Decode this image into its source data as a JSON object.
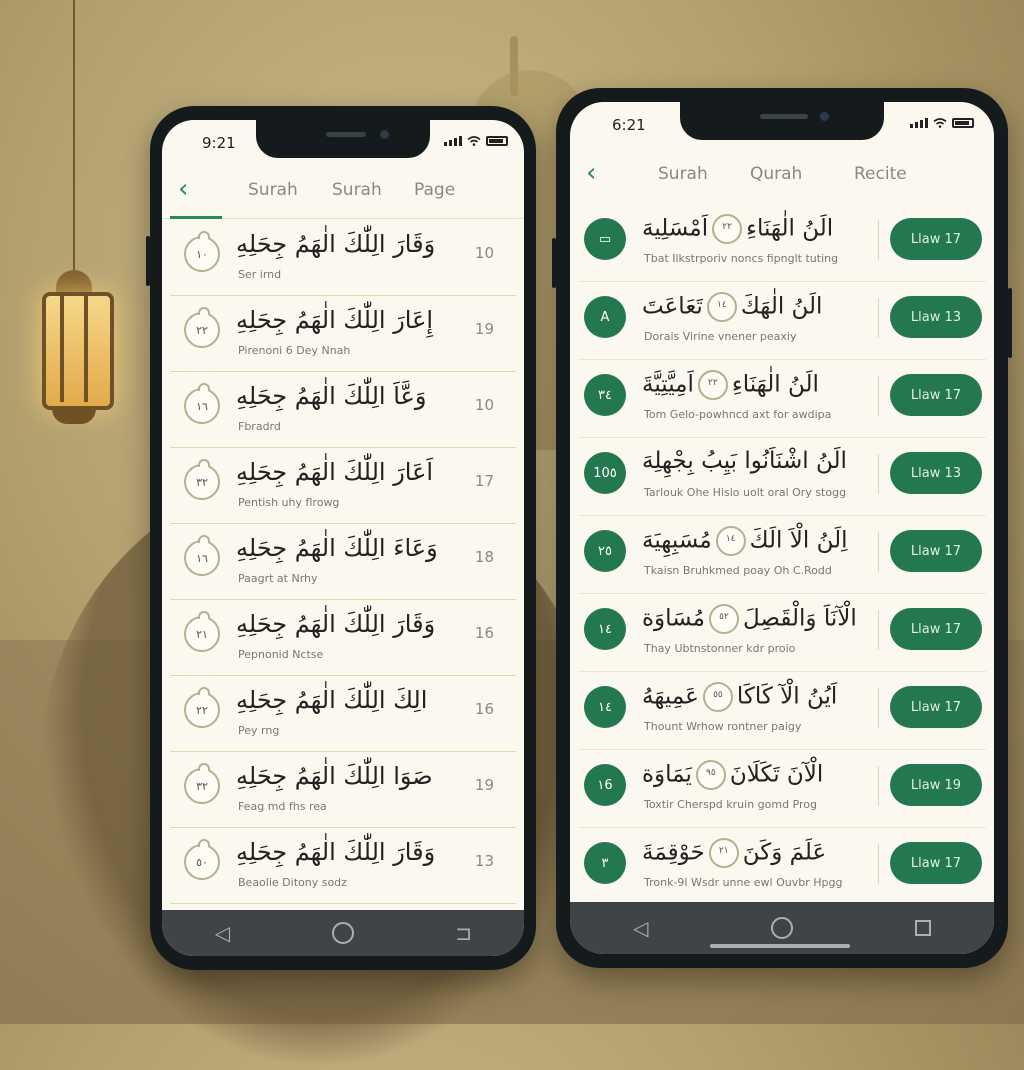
{
  "left_phone": {
    "status_time": "9:21",
    "tabs": [
      "Surah",
      "Surah",
      "Page"
    ],
    "rows": [
      {
        "badge": "١٠",
        "arabic": "وَقَارَ الِلّٰكَ الٰهَمُ جِحَلِهِ",
        "subtitle": "Ser irnd",
        "number": "10"
      },
      {
        "badge": "٢٢",
        "arabic": "إِعَارَ الِلّٰكَ الٰهَمُ جِحَلِهِ",
        "subtitle": "Pirenoni 6 Dey Nnah",
        "number": "19"
      },
      {
        "badge": "١٦",
        "arabic": "وَعَّاَ الِلّٰكَ الٰهَمُ جِحَلِهِ",
        "subtitle": "Fbradrd",
        "number": "10"
      },
      {
        "badge": "٣٢",
        "arabic": "اَعَارَ الِلّٰكَ الٰهَمُ جِحَلِهِ",
        "subtitle": "Pentish uhy flrowg",
        "number": "17"
      },
      {
        "badge": "١٦",
        "arabic": "وَعَاءَ الِلّٰكَ الٰهَمُ جِحَلِهِ",
        "subtitle": "Paagrt at Nrhy",
        "number": "18"
      },
      {
        "badge": "٢١",
        "arabic": "وَقَارَ الِلّٰكَ الٰهَمُ جِحَلِهِ",
        "subtitle": "Pepnonid Nctse",
        "number": "16"
      },
      {
        "badge": "٢٢",
        "arabic": "الِكَ الِلّٰكَ الٰهَمُ جِحَلِهِ",
        "subtitle": "Pey rng",
        "number": "16"
      },
      {
        "badge": "٣٢",
        "arabic": "صَوَا الِلّٰكَ الٰهَمُ جِحَلِهِ",
        "subtitle": "Feag md fhs rea",
        "number": "19"
      },
      {
        "badge": "٥٠",
        "arabic": "وَقَارَ الِلّٰكَ الٰهَمُ جِحَلِهِ",
        "subtitle": "Beaolie Ditony sodz",
        "number": "13"
      }
    ]
  },
  "right_phone": {
    "status_time": "6:21",
    "tabs": [
      "Surah",
      "Qurah",
      "Recite"
    ],
    "rows": [
      {
        "circle": "▭",
        "arabic_a": "الَنُ الٰهَنَاءِ",
        "medal": "٢٢",
        "arabic_b": "اَمْسَلِيهَ",
        "subtitle": "Tbat Ilkstrporiv noncs fipnglt tuting",
        "pill": "Llaw 17"
      },
      {
        "circle": "A",
        "arabic_a": "الَنُ الٰهَكَ",
        "medal": "١٤",
        "arabic_b": "تَعَاعَتَ",
        "subtitle": "Dorais Virine vnener peaxiy",
        "pill": "Llaw 13"
      },
      {
        "circle": "٣٤",
        "arabic_a": "الَنُ الٰهَنَاءِ",
        "medal": "٢٢",
        "arabic_b": "اَمِيَّتِيَّةَ",
        "subtitle": "Tom Gelo-powhncd axt for awdipa",
        "pill": "Llaw 17"
      },
      {
        "circle": "10٥",
        "arabic_a": "الَنُ اشْنَاَنُوا بَيِبُ",
        "medal": "",
        "arabic_b": "بِجْهِلِهَ",
        "subtitle": "Tarlouk Ohe Hislo uolt oral Ory stogg",
        "pill": "Llaw 13"
      },
      {
        "circle": "٢٥",
        "arabic_a": "اِلَنُ الْاَ الَكَ",
        "medal": "١٤",
        "arabic_b": "مُسَبِهِيَهَ",
        "subtitle": "Tkaisn Bruhkmed poay Oh C.Rodd",
        "pill": "Llaw 17"
      },
      {
        "circle": "١٤",
        "arabic_a": "الْآنَاَ وَالْقَصِلَ",
        "medal": "٥٢",
        "arabic_b": "مُسَاوَة",
        "subtitle": "Thay Ubtnstonner kdr proio",
        "pill": "Llaw 17"
      },
      {
        "circle": "١٤",
        "arabic_a": "اَيُنُ الْآ كَاكَا",
        "medal": "٥٥",
        "arabic_b": "عَمِيهَهُ",
        "subtitle": "Thount Wrhow rontner paigy",
        "pill": "Llaw 17"
      },
      {
        "circle": "١6",
        "arabic_a": "الْآنَ تَكَلَانَ",
        "medal": "٩٥",
        "arabic_b": "يَمَاوَة",
        "subtitle": "Toxtir Cherspd kruin gomd Prog",
        "pill": "Llaw 19"
      },
      {
        "circle": "٣",
        "arabic_a": "عَلَمَ وَكَنَ",
        "medal": "٢١",
        "arabic_b": "حَوْقِمَةَ",
        "subtitle": "Tronk-9l Wsdr unne ewl Ouvbr Hpgg",
        "pill": "Llaw 17"
      }
    ]
  },
  "colors": {
    "accent": "#23784f",
    "background": "#fbf8ef",
    "nav_bar": "#3f4446"
  }
}
